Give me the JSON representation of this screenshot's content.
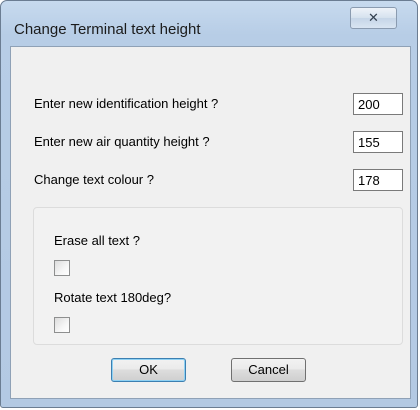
{
  "window": {
    "title": "Change Terminal text height",
    "close_glyph": "✕"
  },
  "fields": [
    {
      "label": "Enter new identification height ?",
      "value": "200"
    },
    {
      "label": "Enter new air quantity height ?",
      "value": "155"
    },
    {
      "label": "Change text colour ?",
      "value": "178"
    }
  ],
  "options": [
    {
      "label": "Erase all text ?",
      "checked": false
    },
    {
      "label": "Rotate text 180deg?",
      "checked": false
    }
  ],
  "buttons": {
    "ok_label": "OK",
    "cancel_label": "Cancel"
  }
}
